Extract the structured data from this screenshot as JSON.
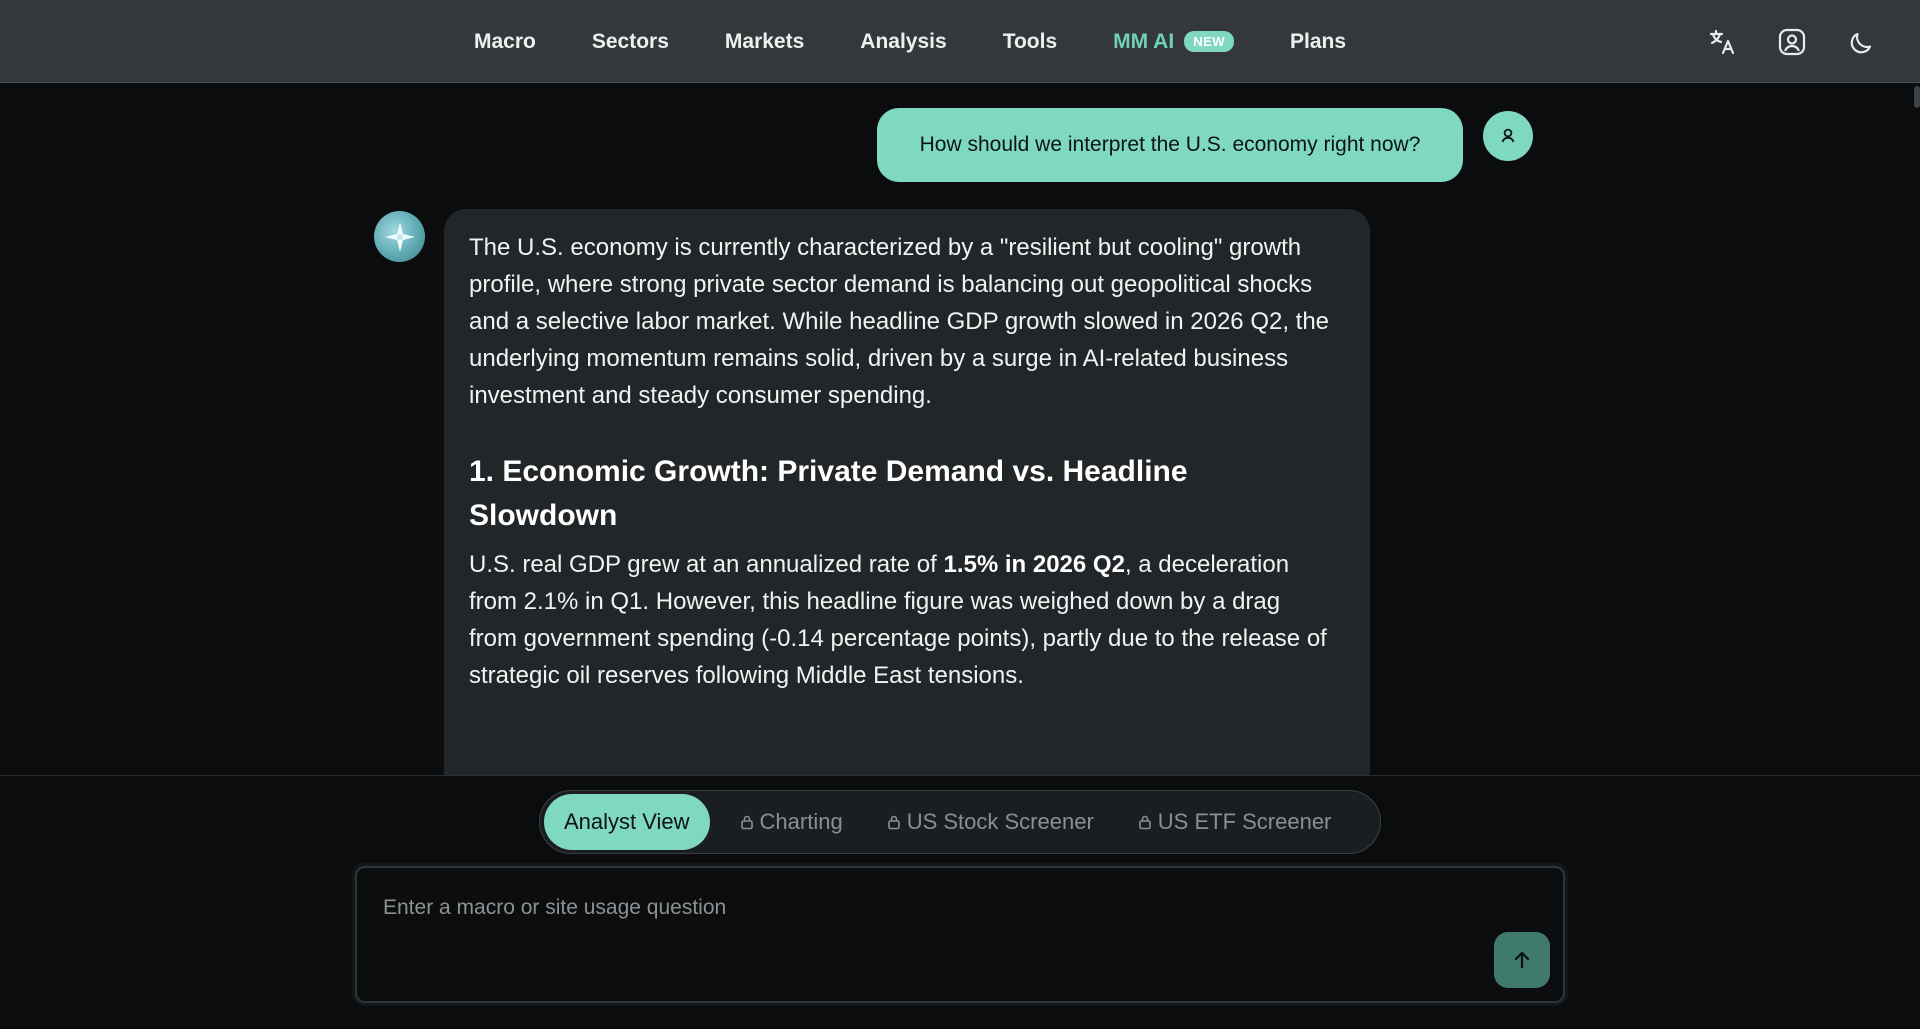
{
  "nav": {
    "items": [
      {
        "label": "Macro"
      },
      {
        "label": "Sectors"
      },
      {
        "label": "Markets"
      },
      {
        "label": "Analysis"
      },
      {
        "label": "Tools"
      },
      {
        "label": "MM AI",
        "badge": "NEW"
      },
      {
        "label": "Plans"
      }
    ],
    "icons": [
      "translate-icon",
      "account-icon",
      "dark-mode-moon-icon"
    ]
  },
  "chat": {
    "user_message": "How should we interpret the U.S. economy right now?",
    "ai_intro": "The U.S. economy is currently characterized by a \"resilient but cooling\" growth profile, where strong private sector demand is balancing out geopolitical shocks and a selective labor market. While headline GDP growth slowed in 2026 Q2, the underlying momentum remains solid, driven by a surge in AI-related business investment and steady consumer spending.",
    "section_heading": "1. Economic Growth: Private Demand vs. Headline Slowdown",
    "section_text_before": "U.S. real GDP grew at an annualized rate of ",
    "section_text_bold": "1.5% in 2026 Q2",
    "section_text_after": ", a deceleration from 2.1% in Q1. However, this headline figure was weighed down by a drag from government spending (-0.14 percentage points), partly due to the release of strategic oil reserves following Middle East tensions."
  },
  "tabs": [
    {
      "label": "Analyst View",
      "active": true,
      "locked": false
    },
    {
      "label": "Charting",
      "active": false,
      "locked": true
    },
    {
      "label": "US Stock Screener",
      "active": false,
      "locked": true
    },
    {
      "label": "US ETF Screener",
      "active": false,
      "locked": true
    }
  ],
  "input": {
    "placeholder": "Enter a macro or site usage question",
    "value": ""
  },
  "colors": {
    "accent": "#7fd9c0",
    "nav_bg": "#34383a",
    "page_bg": "#0a0c0d",
    "ai_bubble_bg": "#222628"
  }
}
